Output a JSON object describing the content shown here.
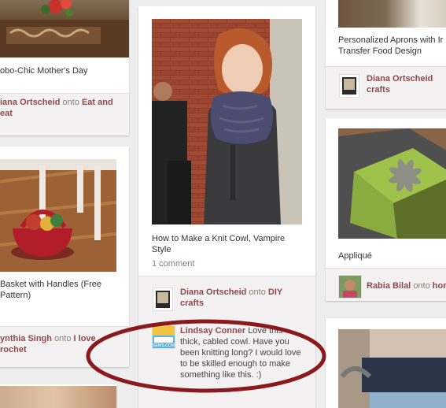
{
  "colors": {
    "page_bg": "#efeeee",
    "link": "#8e4a4a",
    "muted": "#8c7e7e",
    "annotation": "#8b1a1f"
  },
  "left_column": {
    "pin1": {
      "description": "obo-Chic Mother's Day",
      "pinner": "iana Ortscheid",
      "onto": "onto",
      "board": "Eat and",
      "board_line2": "eat"
    },
    "pin2": {
      "description": "Basket with Handles (Free",
      "description_line2": "Pattern)",
      "pinner": "ynthia Singh",
      "onto": "onto",
      "board": "I love",
      "board_line2": "rochet"
    }
  },
  "center_column": {
    "pin": {
      "description": "How to Make a Knit Cowl, Vampire",
      "description_line2": "Style",
      "comment_count": "1 comment",
      "pinner": "Diana Ortscheid",
      "onto": "onto",
      "board": "DIY",
      "board_line2": "crafts",
      "comment": {
        "author": "Lindsay Conner",
        "line1": "Love this",
        "line2": "thick, cabled cowl. Have you",
        "line3": "been knitting long? I would love",
        "line4": "to be skilled enough to make",
        "line5": "something like this. :)",
        "avatar_text": "SEWS.COM"
      }
    }
  },
  "right_column": {
    "pin1": {
      "description": "Personalized Aprons with Ir",
      "description_line2": "Transfer Food Design",
      "pinner": "Diana Ortscheid",
      "onto": "onto",
      "board_line2": "crafts"
    },
    "pin2": {
      "description": "Appliqué",
      "pinner": "Rabia Bilal",
      "onto": "onto",
      "board": "hor"
    }
  }
}
